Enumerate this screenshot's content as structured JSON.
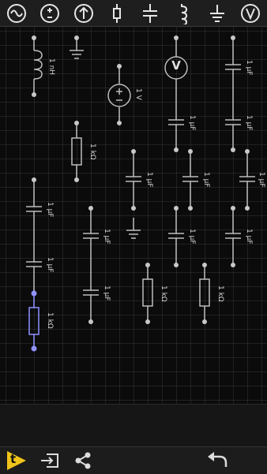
{
  "toolbar": {
    "tools": [
      {
        "icon": "ac-source-icon"
      },
      {
        "icon": "dc-source-icon"
      },
      {
        "icon": "current-source-icon"
      },
      {
        "icon": "resistor-icon"
      },
      {
        "icon": "capacitor-icon"
      },
      {
        "icon": "inductor-icon"
      },
      {
        "icon": "ground-icon"
      },
      {
        "icon": "voltmeter-icon"
      }
    ]
  },
  "circuit": {
    "labels": {
      "inductor": "1 nH",
      "source": "1 V",
      "voltmeter_symbol": "V",
      "r_top": "1 kΩ",
      "r_mid_left": "1 kΩ",
      "r_mid_right": "1 kΩ",
      "r_selected": "1 kΩ",
      "c_vm_left": "1 μF",
      "c_vm_right": "1 μF",
      "c_right_top": "1 μF",
      "c_row_a": "1 μF",
      "c_row_b": "1 μF",
      "c_row_c": "1 μF",
      "c_left_top": "1 μF",
      "c_left_bottom": "1 μF",
      "c_mid_a": "1 μF",
      "c_mid_b": "1 μF",
      "c_mid_c": "1 μF",
      "c_mid_d": "1 μF"
    },
    "colors": {
      "wire": "#bdbdbd",
      "selected": "#8f93ff",
      "canvas": "#0b0b0b"
    }
  },
  "bottom_bar": {
    "icons": [
      "tutorial-icon",
      "export-icon",
      "share-icon",
      "undo-icon"
    ],
    "tutorial_letter": "t"
  }
}
